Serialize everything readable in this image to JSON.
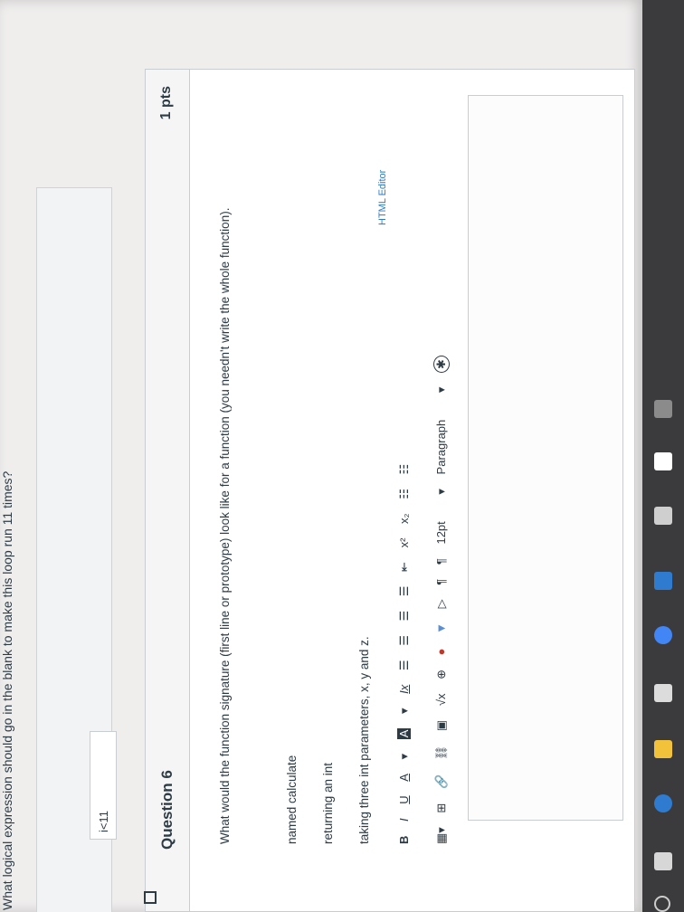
{
  "question5": {
    "text": "What logical expression should go in the blank to make this loop run 11 times?",
    "answer_value": "i<11"
  },
  "question6": {
    "title": "Question 6",
    "points": "1 pts",
    "prompt": "What would the function signature (first line or prototype) look like for a function (you needn't write the whole function).",
    "lines": [
      "named calculate",
      "returning an int",
      "taking three int parameters, x, y and z."
    ]
  },
  "editor": {
    "html_editor_label": "HTML Editor",
    "toolbar1": [
      "B",
      "I",
      "U",
      "A",
      "A",
      "Ix",
      "x²",
      "x₂"
    ],
    "toolbar2": [
      "√x"
    ],
    "font_size": "12pt",
    "paragraph": "Paragraph"
  }
}
